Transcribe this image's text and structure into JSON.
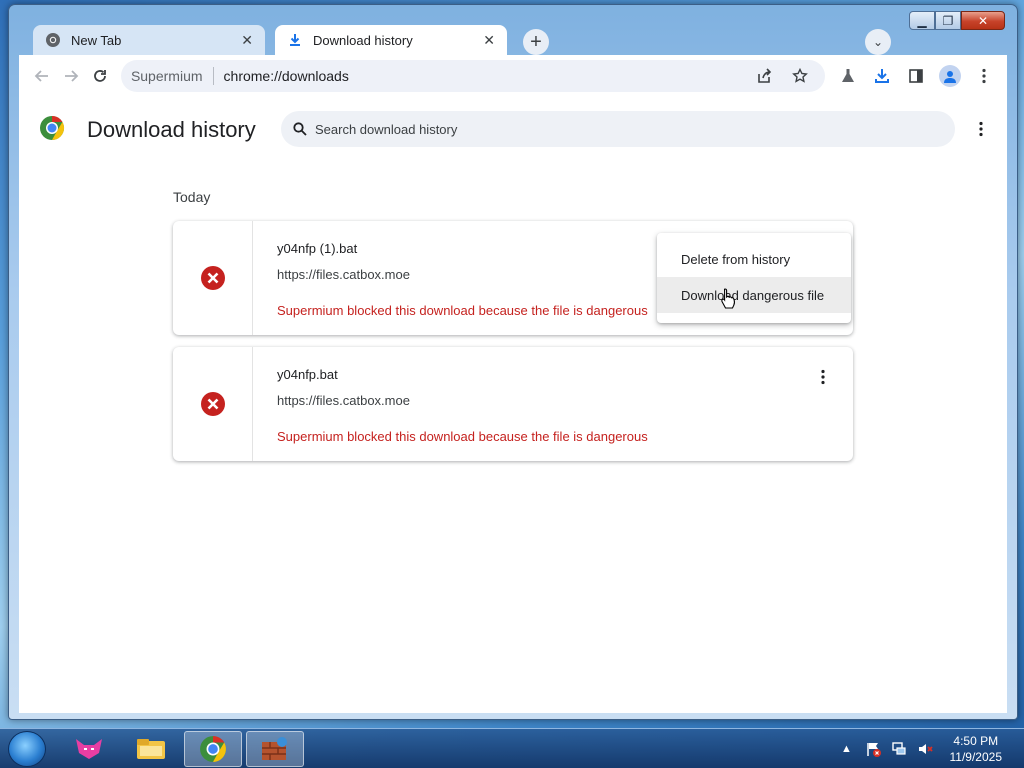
{
  "browser": {
    "tabs": [
      {
        "label": "New Tab",
        "icon": "chrome-icon"
      },
      {
        "label": "Download history",
        "icon": "download-icon"
      }
    ],
    "omnibox": {
      "site_label": "Supermium",
      "url": "chrome://downloads"
    }
  },
  "page": {
    "title": "Download history",
    "search_placeholder": "Search download history",
    "section": "Today"
  },
  "downloads": [
    {
      "filename": "y04nfp (1).bat",
      "url": "https://files.catbox.moe",
      "warning": "Supermium blocked this download because the file is dangerous"
    },
    {
      "filename": "y04nfp.bat",
      "url": "https://files.catbox.moe",
      "warning": "Supermium blocked this download because the file is dangerous"
    }
  ],
  "context_menu": {
    "items": [
      "Delete from history",
      "Download dangerous file"
    ],
    "hovered_index": 1
  },
  "taskbar": {
    "time": "4:50 PM",
    "date": "11/9/2025"
  },
  "colors": {
    "danger": "#c5221f",
    "accent": "#1a73e8"
  }
}
